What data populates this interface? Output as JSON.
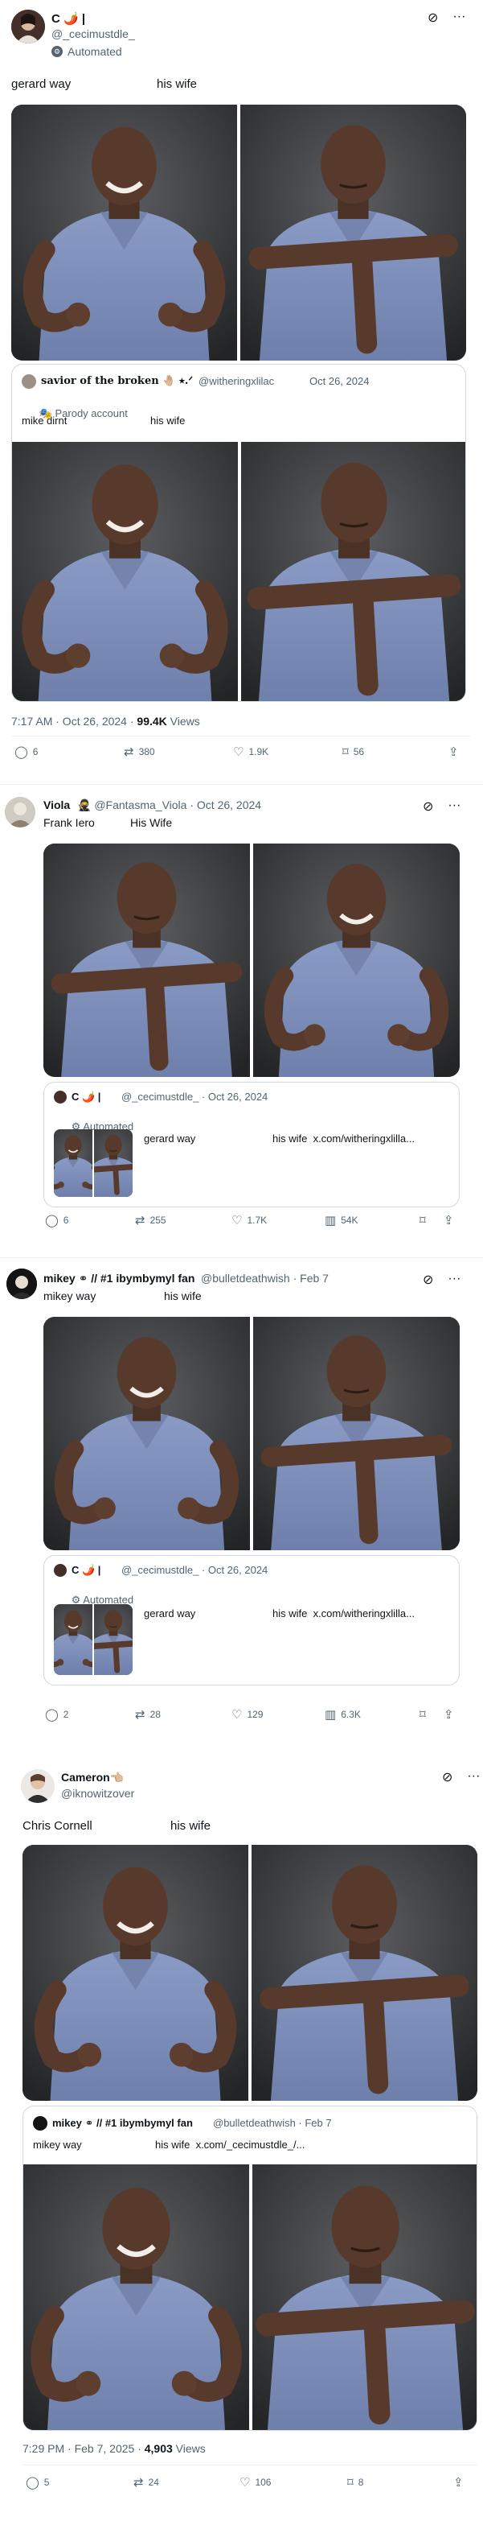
{
  "post1": {
    "name": "C 🌶️ |",
    "handle": "@_cecimustdle_",
    "automated": "Automated",
    "text_left": "gerard way",
    "text_right": "his wife",
    "quote": {
      "name": "savior of the broken 🤚🏼 ⭑.ᐟ",
      "handle": "@witheringxlilac",
      "date": "Oct 26, 2024",
      "parody": "Parody account",
      "text_left": "mike dirnt",
      "text_right": "his wife"
    },
    "time": "7:17 AM · Oct 26, 2024 · ",
    "views_count": "99.4K",
    "views_label": " Views",
    "stats": {
      "replies": "6",
      "reposts": "380",
      "likes": "1.9K",
      "bookmarks": "56"
    }
  },
  "post2": {
    "name": "Viola",
    "handle": "@Fantasma_Viola · Oct 26, 2024",
    "text_left": "Frank Iero",
    "text_right": "His Wife",
    "quote": {
      "name": "C 🌶️ |",
      "handle": "@_cecimustdle_ · Oct 26, 2024",
      "automated": "Automated",
      "text_left": "gerard way",
      "text_right": "his wife  x.com/witheringxlilla..."
    },
    "stats": {
      "replies": "6",
      "reposts": "255",
      "likes": "1.7K",
      "views": "54K"
    }
  },
  "post3": {
    "name": "mikey ⚭ // #1 ibymbymyl fan",
    "handle": "@bulletdeathwish · Feb 7",
    "text_left": "mikey way",
    "text_right": "his wife",
    "quote": {
      "name": "C 🌶️ |",
      "handle": "@_cecimustdle_ · Oct 26, 2024",
      "automated": "Automated",
      "text_left": "gerard way",
      "text_right": "his wife  x.com/witheringxlilla..."
    },
    "stats": {
      "replies": "2",
      "reposts": "28",
      "likes": "129",
      "views": "6.3K"
    }
  },
  "post4": {
    "name": "Cameron👈🏼",
    "handle": "@iknowitzover",
    "text_left": "Chris Cornell",
    "text_right": "his wife",
    "quote": {
      "name": "mikey ⚭ // #1 ibymbymyl fan",
      "handle": "@bulletdeathwish · Feb 7",
      "text_left": "mikey way",
      "text_right": "his wife  x.com/_cecimustdle_/..."
    },
    "time": "7:29 PM · Feb 7, 2025 · ",
    "views_count": "4,903",
    "views_label": " Views",
    "stats": {
      "replies": "5",
      "reposts": "24",
      "likes": "106",
      "bookmarks": "8"
    }
  },
  "icons": {
    "grok": "⊘",
    "more": "···",
    "reply": "◯",
    "repost": "⇄",
    "like": "♡",
    "views": "▥",
    "bookmark": "⌑",
    "share": "⇪"
  }
}
